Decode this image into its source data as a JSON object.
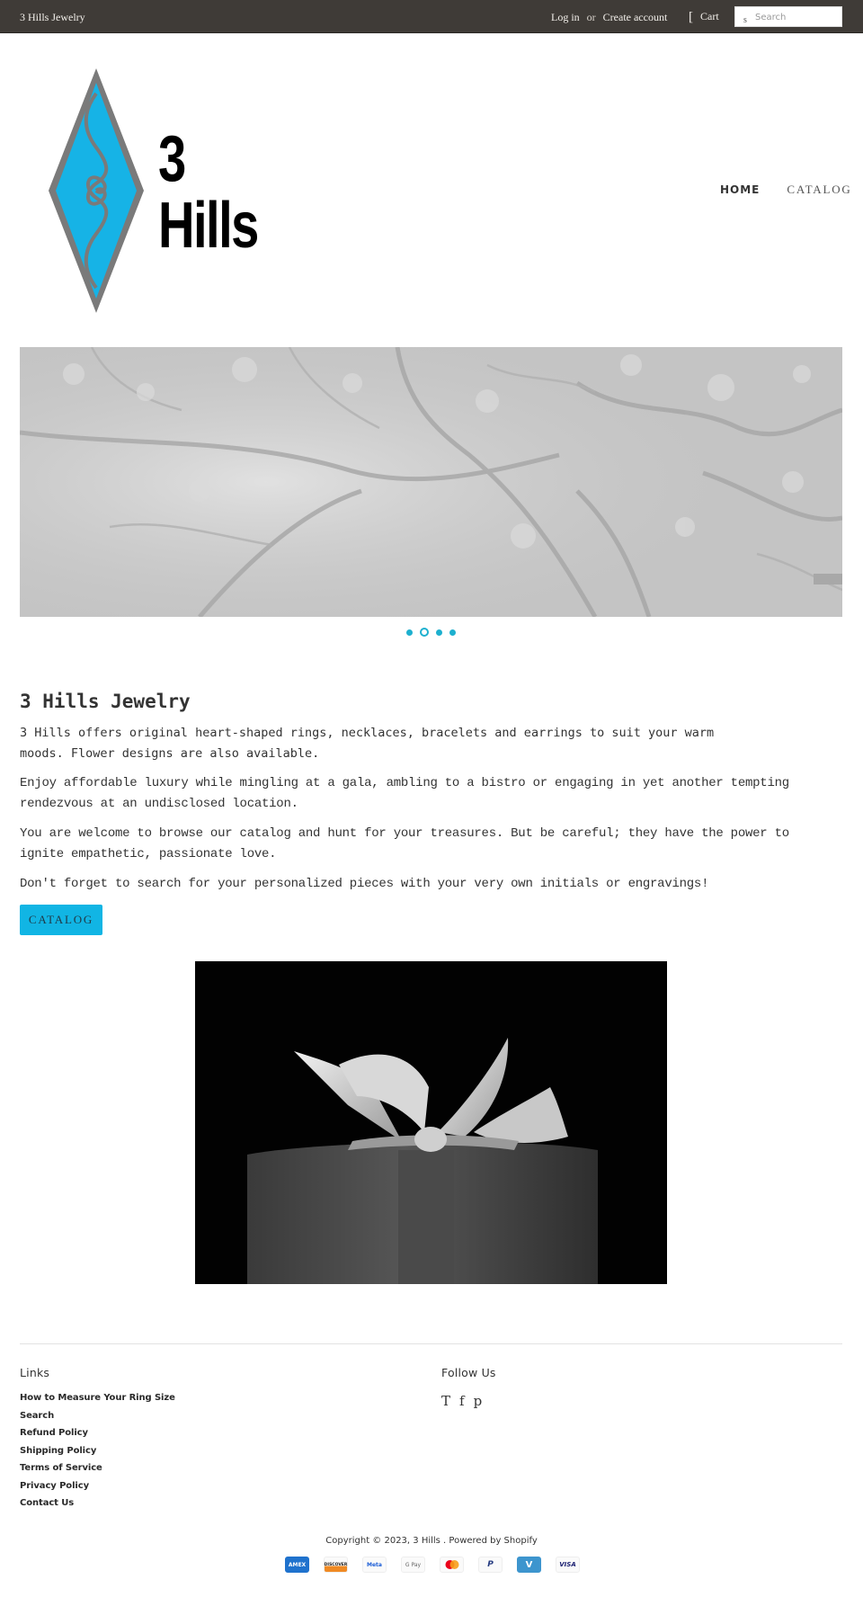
{
  "topbar": {
    "brand": "3 Hills Jewelry",
    "login": "Log in",
    "or": "or",
    "create_account": "Create account",
    "cart_icon": "[",
    "cart": "Cart",
    "search_icon": "s",
    "search_placeholder": "Search"
  },
  "header": {
    "logo_line1": "3",
    "logo_line2": "Hills",
    "logo_colors": {
      "fill": "#16b3e6",
      "stroke": "#7a7a7a"
    },
    "nav": [
      {
        "label": "HOME",
        "active": true
      },
      {
        "label": "CATALOG",
        "active": false
      }
    ]
  },
  "slideshow": {
    "slide_count": 4,
    "active_index": 1,
    "dot_color": "#1db0cf"
  },
  "main": {
    "title": "3 Hills Jewelry",
    "paragraphs": [
      "3 Hills offers original heart-shaped rings, necklaces, bracelets and earrings to suit your warm moods. Flower designs are also available.",
      "Enjoy affordable luxury while mingling at a gala, ambling to a bistro or engaging in yet another tempting rendezvous at an undisclosed location.",
      "You are welcome to browse our catalog and hunt for your treasures.  But be careful; they have the power to ignite empathetic, passionate love.",
      "Don't forget to search for your personalized pieces with your very own initials or engravings!"
    ],
    "cta_label": "CATALOG",
    "accent": "#11b5e4"
  },
  "footer": {
    "links_heading": "Links",
    "links": [
      "How to Measure Your Ring Size",
      "Search",
      "Refund Policy",
      "Shipping Policy",
      "Terms of Service",
      "Privacy Policy",
      "Contact Us"
    ],
    "follow_heading": "Follow Us",
    "social": [
      {
        "icon": "twitter-icon",
        "glyph": "T"
      },
      {
        "icon": "facebook-icon",
        "glyph": "f"
      },
      {
        "icon": "pinterest-icon",
        "glyph": "p"
      }
    ],
    "copyright": "Copyright © 2023, 3 Hills . Powered by Shopify",
    "payments": [
      {
        "name": "amex",
        "label": "AMEX"
      },
      {
        "name": "discover",
        "label": "DISCOVER"
      },
      {
        "name": "meta-pay",
        "label": "Meta"
      },
      {
        "name": "google-pay",
        "label": "G Pay"
      },
      {
        "name": "mastercard",
        "label": ""
      },
      {
        "name": "paypal",
        "label": "P"
      },
      {
        "name": "venmo",
        "label": "V"
      },
      {
        "name": "visa",
        "label": "VISA"
      }
    ]
  }
}
